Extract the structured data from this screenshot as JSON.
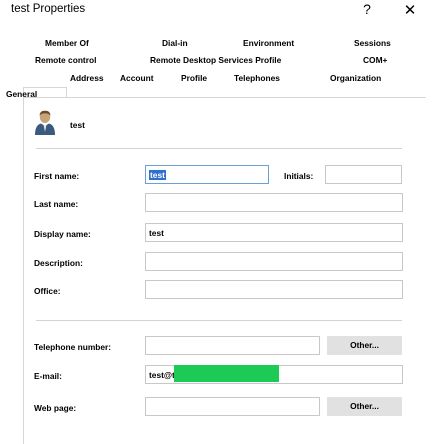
{
  "window": {
    "title": "test Properties",
    "help_glyph": "?",
    "close_glyph": "✕"
  },
  "tabs": {
    "row1": [
      "Member Of",
      "Dial-in",
      "Environment",
      "Sessions"
    ],
    "row2": [
      "Remote control",
      "Remote Desktop Services Profile",
      "COM+"
    ],
    "row3": [
      "General",
      "Address",
      "Account",
      "Profile",
      "Telephones",
      "Organization"
    ],
    "active": "General"
  },
  "general": {
    "display_name_header": "test",
    "first_name_label": "First name:",
    "first_name_value": "test",
    "initials_label": "Initials:",
    "initials_value": "",
    "last_name_label": "Last name:",
    "last_name_value": "",
    "display_name_label": "Display name:",
    "display_name_value": "test",
    "description_label": "Description:",
    "description_value": "",
    "office_label": "Office:",
    "office_value": "",
    "telephone_label": "Telephone number:",
    "telephone_value": "",
    "telephone_other": "Other...",
    "email_label": "E-mail:",
    "email_value": "test@t",
    "webpage_label": "Web page:",
    "webpage_value": "",
    "webpage_other": "Other..."
  },
  "colors": {
    "redaction": "#1bcb56",
    "selection": "#2f6fd0",
    "button_face": "#e1e1e1"
  },
  "icons": {
    "user": "user-icon"
  }
}
